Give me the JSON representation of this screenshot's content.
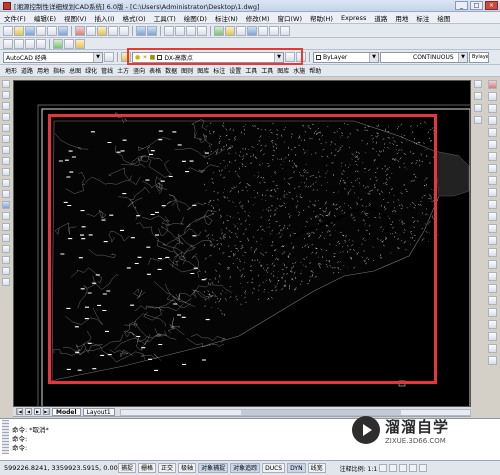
{
  "window": {
    "title": "[湘源控制性详细规划CAD系统] 6.0版 - [C:\\Users\\Administrator\\Desktop\\1.dwg]",
    "controls": [
      "_",
      "□",
      "×"
    ]
  },
  "menus": [
    "文件(F)",
    "编辑(E)",
    "视图(V)",
    "插入(I)",
    "格式(O)",
    "工具(T)",
    "绘图(D)",
    "标注(N)",
    "修改(M)",
    "窗口(W)",
    "帮助(H)",
    "Express",
    "道路",
    "用地",
    "标注",
    "绘图"
  ],
  "toolbar": {
    "workspace": "AutoCAD 经典",
    "layer": "DX-高散点",
    "color": "ByLayer",
    "linetype": "CONTINUOUS",
    "lineweight": "Bylayer"
  },
  "module_tabs": [
    "地形",
    "道路",
    "用地",
    "指标",
    "总图",
    "绿化",
    "管线",
    "土方",
    "竖向",
    "表格",
    "数据",
    "图则",
    "图库",
    "标注",
    "设置",
    "工具",
    "工具",
    "图库",
    "水施",
    "帮助"
  ],
  "model_tabs": {
    "model": "Model",
    "layout": "Layout1"
  },
  "command": {
    "line1": "命令: *取消*",
    "line2": "命令:",
    "line3": "命令:"
  },
  "status": {
    "coords": "599226.8241, 3359923.5915, 0.0000",
    "buttons": [
      "捕捉",
      "栅格",
      "正交",
      "极轴",
      "对象捕捉",
      "对象追踪",
      "DUCS",
      "DYN",
      "线宽"
    ],
    "annotation_scale": "注释比例: 1:1"
  },
  "watermark": {
    "name": "溜溜自学",
    "url": "ZIXUE.3D66.COM"
  },
  "colors": {
    "highlight": "#e8353b",
    "canvas": "#000000"
  }
}
